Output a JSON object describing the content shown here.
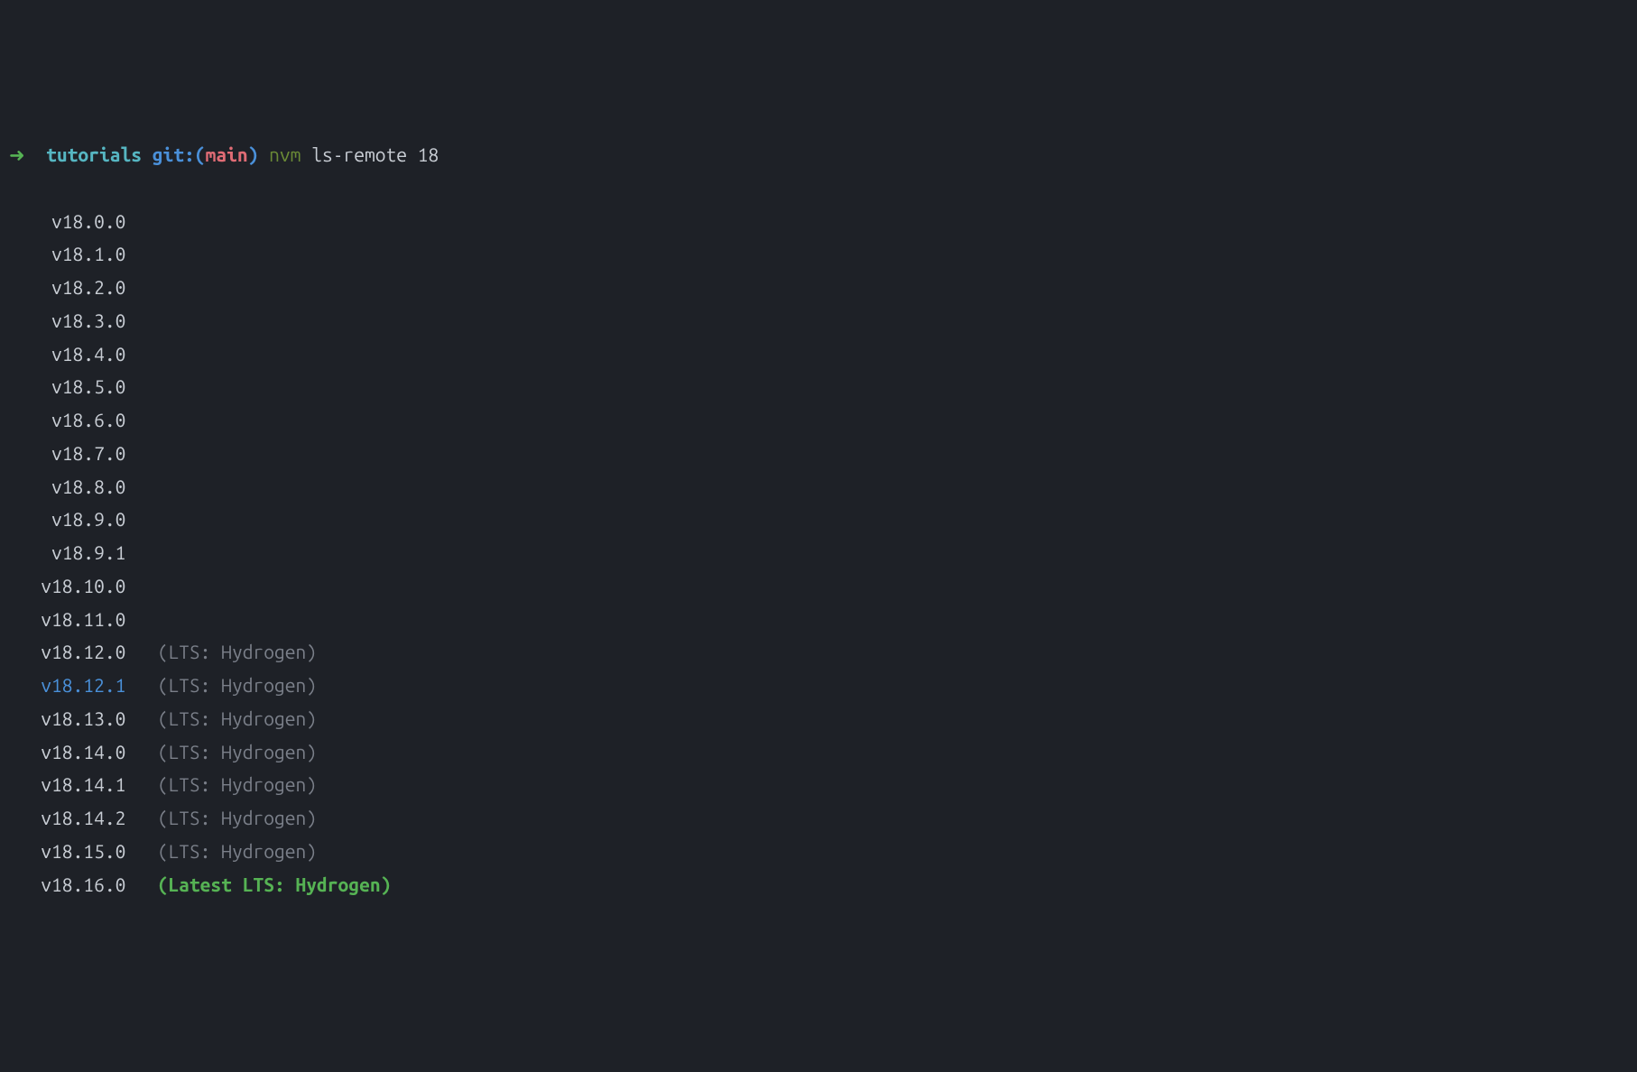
{
  "prompt": {
    "arrow": "➜",
    "directory": "tutorials",
    "git_prefix": "git:(",
    "branch": "main",
    "git_suffix": ")",
    "command": "nvm",
    "args": "ls-remote 18"
  },
  "versions": [
    {
      "version": "v18.0.0",
      "label": "",
      "highlight": false,
      "latest": false
    },
    {
      "version": "v18.1.0",
      "label": "",
      "highlight": false,
      "latest": false
    },
    {
      "version": "v18.2.0",
      "label": "",
      "highlight": false,
      "latest": false
    },
    {
      "version": "v18.3.0",
      "label": "",
      "highlight": false,
      "latest": false
    },
    {
      "version": "v18.4.0",
      "label": "",
      "highlight": false,
      "latest": false
    },
    {
      "version": "v18.5.0",
      "label": "",
      "highlight": false,
      "latest": false
    },
    {
      "version": "v18.6.0",
      "label": "",
      "highlight": false,
      "latest": false
    },
    {
      "version": "v18.7.0",
      "label": "",
      "highlight": false,
      "latest": false
    },
    {
      "version": "v18.8.0",
      "label": "",
      "highlight": false,
      "latest": false
    },
    {
      "version": "v18.9.0",
      "label": "",
      "highlight": false,
      "latest": false
    },
    {
      "version": "v18.9.1",
      "label": "",
      "highlight": false,
      "latest": false
    },
    {
      "version": "v18.10.0",
      "label": "",
      "highlight": false,
      "latest": false
    },
    {
      "version": "v18.11.0",
      "label": "",
      "highlight": false,
      "latest": false
    },
    {
      "version": "v18.12.0",
      "label": "(LTS: Hydrogen)",
      "highlight": false,
      "latest": false
    },
    {
      "version": "v18.12.1",
      "label": "(LTS: Hydrogen)",
      "highlight": true,
      "latest": false
    },
    {
      "version": "v18.13.0",
      "label": "(LTS: Hydrogen)",
      "highlight": false,
      "latest": false
    },
    {
      "version": "v18.14.0",
      "label": "(LTS: Hydrogen)",
      "highlight": false,
      "latest": false
    },
    {
      "version": "v18.14.1",
      "label": "(LTS: Hydrogen)",
      "highlight": false,
      "latest": false
    },
    {
      "version": "v18.14.2",
      "label": "(LTS: Hydrogen)",
      "highlight": false,
      "latest": false
    },
    {
      "version": "v18.15.0",
      "label": "(LTS: Hydrogen)",
      "highlight": false,
      "latest": false
    },
    {
      "version": "v18.16.0",
      "label": "(Latest LTS: Hydrogen)",
      "highlight": false,
      "latest": true
    }
  ]
}
